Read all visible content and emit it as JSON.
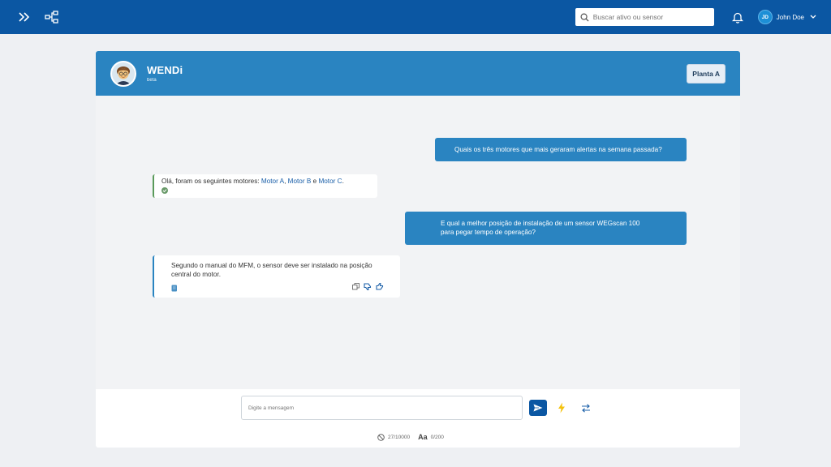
{
  "topbar": {
    "search_placeholder": "Buscar ativo ou sensor",
    "user_initials": "JD",
    "user_name": "John Doe"
  },
  "chat": {
    "title": "WENDi",
    "subtitle": "beta",
    "plant_button": "Planta A",
    "messages": [
      {
        "from": "user",
        "text": "Quais os três motores que mais geraram alertas na semana passada?"
      },
      {
        "from": "bot",
        "prefix": "Olá, foram os seguintes motores: ",
        "links": [
          "Motor A",
          "Motor B",
          "Motor C"
        ],
        "sep1": ", ",
        "sep2": " e ",
        "suffix": "."
      },
      {
        "from": "user",
        "line1": "E qual a melhor posição de instalação de um sensor WEGscan 100",
        "line2": "para pegar tempo de operação?"
      },
      {
        "from": "bot",
        "line1": "Segundo o manual do MFM, o sensor deve ser instalado na posição",
        "line2": "central do motor."
      }
    ],
    "input_placeholder": "Digite a mensagem",
    "char_count": "27/10000",
    "font_label": "Aa",
    "word_count": "0/200"
  },
  "colors": {
    "topbar": "#0b57a3",
    "header": "#2a84c1",
    "user_bubble": "#2a84c1",
    "bot_border_success": "#5a9a5a",
    "bot_border_info": "#2a84c1",
    "bolt": "#f4c20d"
  }
}
